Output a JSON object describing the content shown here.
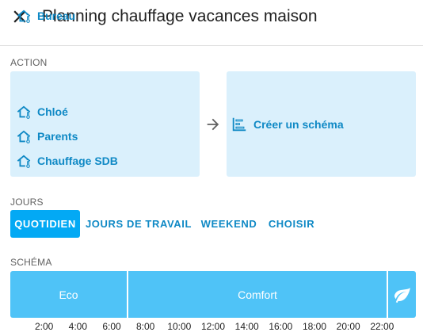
{
  "dialog": {
    "title": "Planning chauffage vacances maison",
    "close_icon": "close-icon"
  },
  "action": {
    "label": "ACTION",
    "entities": [
      {
        "name": "Bureau",
        "icon": "home-thermometer-icon"
      },
      {
        "name": "Chloé",
        "icon": "home-thermometer-icon"
      },
      {
        "name": "Parents",
        "icon": "home-thermometer-icon"
      },
      {
        "name": "Chauffage SDB",
        "icon": "home-thermometer-icon"
      }
    ],
    "arrow_icon": "arrow-right-icon",
    "create_schema_label": "Créer un schéma",
    "create_schema_icon": "timeline-icon"
  },
  "days": {
    "label": "JOURS",
    "options": [
      {
        "label": "QUOTIDIEN",
        "active": true
      },
      {
        "label": "JOURS DE TRAVAIL",
        "active": false
      },
      {
        "label": "WEEKEND",
        "active": false
      },
      {
        "label": "CHOISIR",
        "active": false
      }
    ]
  },
  "schema": {
    "label": "SCHÉMA",
    "slots": [
      {
        "label": "Eco",
        "start": "00:00",
        "end": "07:00"
      },
      {
        "label": "Comfort",
        "start": "07:00",
        "end": "22:30"
      },
      {
        "label": "",
        "icon": "leaf-icon",
        "start": "22:30",
        "end": "24:00"
      }
    ],
    "ticks": [
      "2:00",
      "4:00",
      "6:00",
      "8:00",
      "10:00",
      "12:00",
      "14:00",
      "16:00",
      "18:00",
      "20:00",
      "22:00"
    ]
  },
  "colors": {
    "accent": "#03a9f4",
    "accent_text": "#0f89c5",
    "entity_bg": "#daf0fc",
    "slot_bg": "#4fc3f7"
  }
}
